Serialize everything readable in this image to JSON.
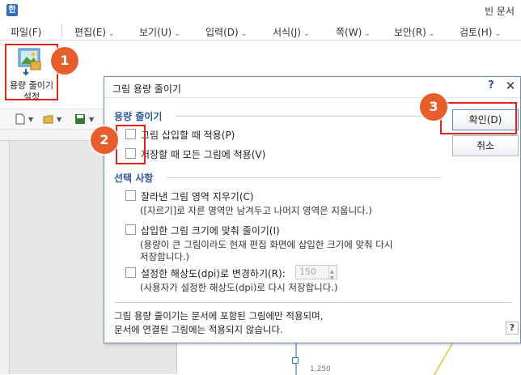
{
  "window": {
    "app_icon": "한",
    "title": "빈 문서"
  },
  "menubar": {
    "file": "파일(F)",
    "items": [
      "편집(E)",
      "보기(U)",
      "입력(D)",
      "서식(J)",
      "쪽(W)",
      "보안(R)",
      "검토(H)"
    ]
  },
  "ribbon": {
    "button_label_1": "용량 줄이기",
    "button_label_2": "설정"
  },
  "badges": [
    "1",
    "2",
    "3"
  ],
  "dialog": {
    "title": "그림 용량 줄이기",
    "help": "?",
    "close": "✕",
    "section1": {
      "title": "용량 줄이기",
      "options": [
        "그림 삽입할 때 적용(P)",
        "저장할 때 모든 그림에 적용(V)"
      ]
    },
    "section2": {
      "title": "선택 사항",
      "opt1": "잘라낸 그림 영역 지우기(C)",
      "opt1_desc": "([자르기]로 자른 영역만 남겨두고 나머지 영역은 지웁니다.)",
      "opt2": "삽입한 그림 크기에 맞춰 줄이기(I)",
      "opt2_desc_1": "(용량이 큰 그림이라도 현재 편집 화면에 삽입한 크기에 맞춰 다시",
      "opt2_desc_2": "저장합니다.)",
      "opt3": "설정한 해상도(dpi)로 변경하기(R):",
      "dpi_value": "150",
      "opt3_desc": "(사용자가 설정한 해상도(dpi)로 다시 저장합니다.)"
    },
    "footer_note_1": "그림 용량 줄이기는 문서에 포함된 그림에만 적용되며,",
    "footer_note_2": "문서에 연결된 그림에는 적용되지 않습니다.",
    "footer_help": "?",
    "ok": "확인(D)",
    "cancel": "취소"
  },
  "page": {
    "number_label": "1,250"
  },
  "colors": {
    "accent_red": "#e2231a",
    "badge": "#e55e2c",
    "section_title": "#2d5a98"
  }
}
